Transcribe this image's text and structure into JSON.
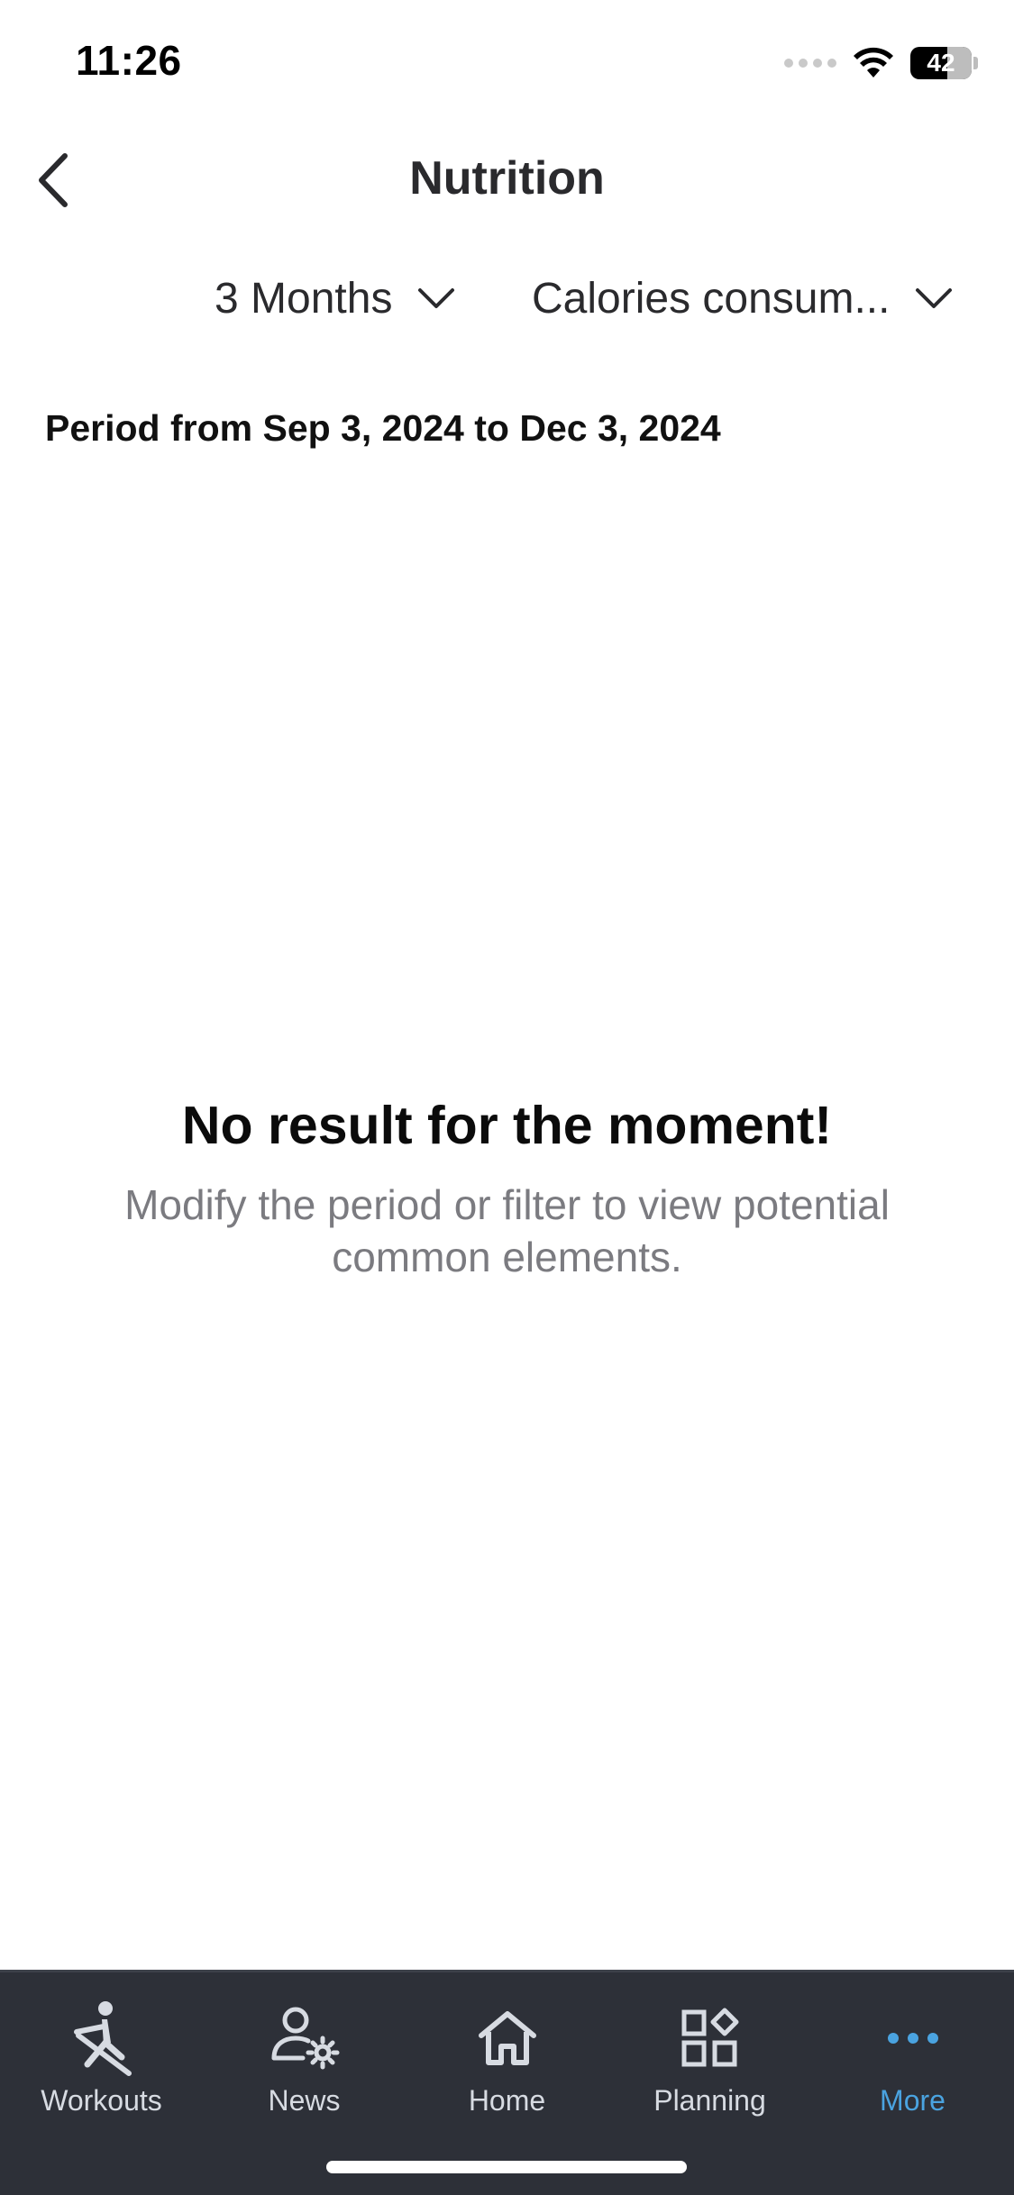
{
  "status_bar": {
    "time": "11:26",
    "battery": "42"
  },
  "header": {
    "title": "Nutrition",
    "back_icon": "chevron-left-icon"
  },
  "filters": {
    "period": {
      "selected": "3 Months",
      "icon": "chevron-down-icon"
    },
    "metric": {
      "selected": "Calories consum...",
      "icon": "chevron-down-icon"
    }
  },
  "period_text": "Period from Sep 3, 2024 to Dec 3, 2024",
  "empty_state": {
    "title": "No result for the moment!",
    "message": "Modify the period or filter to view potential common elements."
  },
  "tab_bar": {
    "active_color": "#4aa3e0",
    "inactive_color": "#d7dbe2",
    "background": "#2d3038",
    "tabs": [
      {
        "label": "Workouts",
        "icon": "rower-icon",
        "active": false
      },
      {
        "label": "News",
        "icon": "user-gear-icon",
        "active": false
      },
      {
        "label": "Home",
        "icon": "home-icon",
        "active": false
      },
      {
        "label": "Planning",
        "icon": "widgets-icon",
        "active": false
      },
      {
        "label": "More",
        "icon": "more-dots-icon",
        "active": true
      }
    ]
  }
}
